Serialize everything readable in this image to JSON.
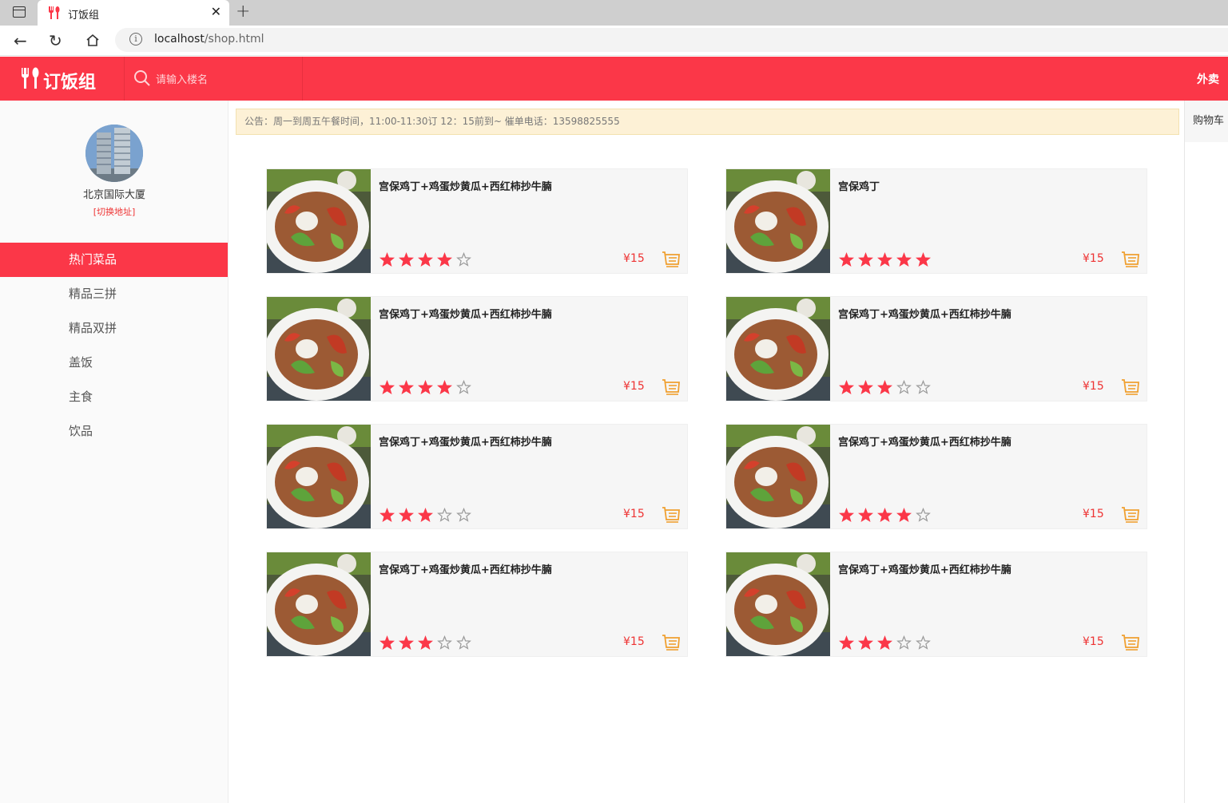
{
  "browser": {
    "tab_title": "订饭组",
    "url_host": "localhost",
    "url_path": "/shop.html"
  },
  "header": {
    "logo_text": "订饭组",
    "search_placeholder": "请输入楼名",
    "takeout_label": "外卖",
    "accent_color": "#fb3748"
  },
  "sidebar": {
    "building_name": "北京国际大厦",
    "switch_address": "[切换地址]",
    "menu": [
      {
        "label": "热门菜品",
        "active": true
      },
      {
        "label": "精品三拼",
        "active": false
      },
      {
        "label": "精品双拼",
        "active": false
      },
      {
        "label": "盖饭",
        "active": false
      },
      {
        "label": "主食",
        "active": false
      },
      {
        "label": "饮品",
        "active": false
      }
    ]
  },
  "notice": "公告：周一到周五午餐时间，11:00-11:30订 12：15前到~ 催单电话：13598825555",
  "cart": {
    "label": "购物车"
  },
  "dishes": [
    {
      "name": "宫保鸡丁+鸡蛋炒黄瓜+西红柿抄牛腩",
      "rating": 4,
      "price": "¥15"
    },
    {
      "name": "宫保鸡丁",
      "rating": 5,
      "price": "¥15"
    },
    {
      "name": "宫保鸡丁+鸡蛋炒黄瓜+西红柿抄牛腩",
      "rating": 4,
      "price": "¥15"
    },
    {
      "name": "宫保鸡丁+鸡蛋炒黄瓜+西红柿抄牛腩",
      "rating": 3,
      "price": "¥15"
    },
    {
      "name": "宫保鸡丁+鸡蛋炒黄瓜+西红柿抄牛腩",
      "rating": 3,
      "price": "¥15"
    },
    {
      "name": "宫保鸡丁+鸡蛋炒黄瓜+西红柿抄牛腩",
      "rating": 4,
      "price": "¥15"
    },
    {
      "name": "宫保鸡丁+鸡蛋炒黄瓜+西红柿抄牛腩",
      "rating": 3,
      "price": "¥15"
    },
    {
      "name": "宫保鸡丁+鸡蛋炒黄瓜+西红柿抄牛腩",
      "rating": 3,
      "price": "¥15"
    }
  ],
  "icons": {
    "star_color": "#fb3748",
    "cart_icon_color": "#f0a030"
  }
}
